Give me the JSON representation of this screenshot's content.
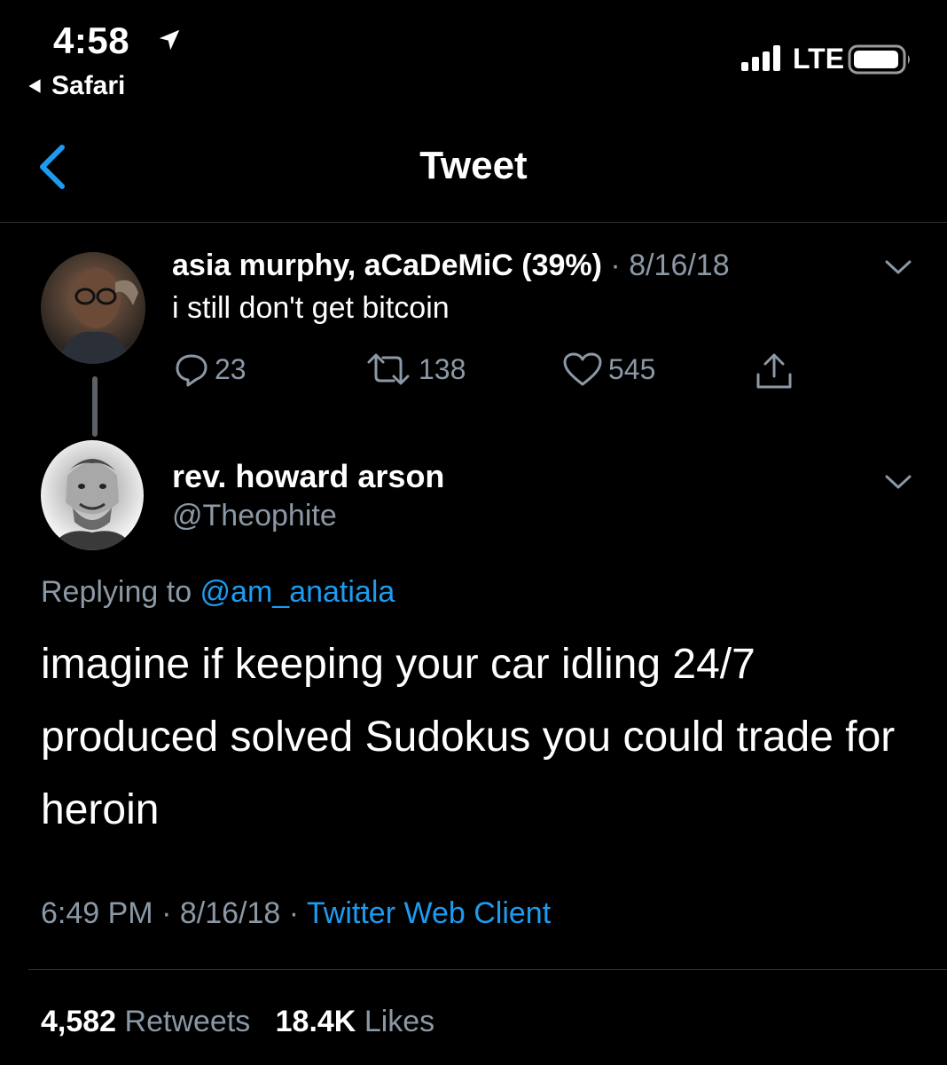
{
  "status_bar": {
    "time": "4:58",
    "back_app": "Safari",
    "network": "LTE",
    "icons": [
      "location-arrow-icon",
      "signal-bars-icon",
      "battery-icon"
    ]
  },
  "nav": {
    "title": "Tweet",
    "back_icon": "chevron-left-icon"
  },
  "parent_tweet": {
    "author": "asia murphy, aCaDeMiC (39%)",
    "separator": " · ",
    "date": "8/16/18",
    "text": "i still don't get bitcoin",
    "replies": "23",
    "retweets": "138",
    "likes": "545"
  },
  "main_tweet": {
    "author": "rev. howard arson",
    "handle": "@Theophite",
    "replying_prefix": "Replying to ",
    "replying_to": "@am_anatiala",
    "text": "imagine if keeping your car idling 24/7 produced solved Sudokus you could trade for heroin",
    "time": "6:49 PM",
    "date": "8/16/18",
    "client": "Twitter Web Client",
    "retweets_count": "4,582",
    "retweets_label": "Retweets",
    "likes_count": "18.4K",
    "likes_label": "Likes"
  },
  "colors": {
    "background": "#000000",
    "text": "#ffffff",
    "secondary": "#8b98a5",
    "link": "#1d9bf0",
    "divider": "#2f3336"
  }
}
